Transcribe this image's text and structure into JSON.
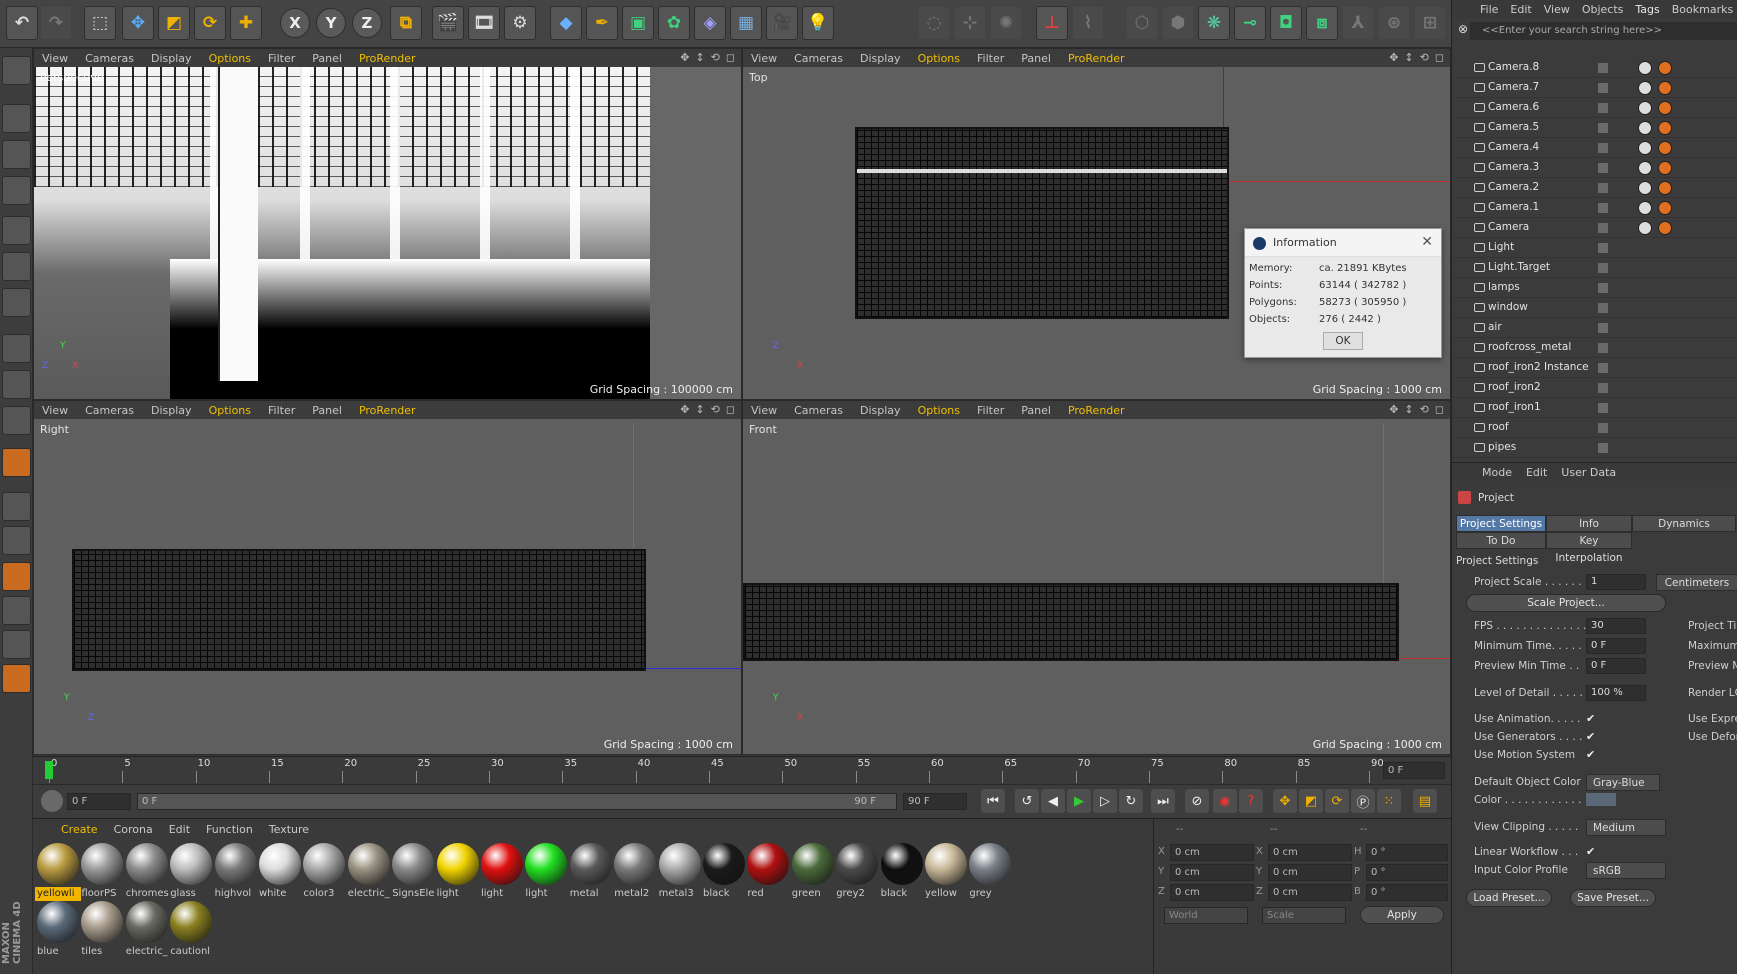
{
  "top_menu": [
    "File",
    "Edit",
    "View",
    "Objects",
    "Tags",
    "Bookmarks"
  ],
  "object_search_placeholder": "<<Enter your search string here>>",
  "viewport_menu": [
    "View",
    "Cameras",
    "Display",
    "Options",
    "Filter",
    "Panel",
    "ProRender"
  ],
  "viewports": {
    "perspective": {
      "label": "Perspective",
      "grid_spacing": "Grid Spacing : 100000 cm"
    },
    "top": {
      "label": "Top",
      "grid_spacing": "Grid Spacing : 1000 cm"
    },
    "right": {
      "label": "Right",
      "grid_spacing": "Grid Spacing : 1000 cm"
    },
    "front": {
      "label": "Front",
      "grid_spacing": "Grid Spacing : 1000 cm"
    }
  },
  "axes": {
    "x": "X",
    "y": "Y",
    "z": "Z"
  },
  "info_dialog": {
    "title": "Information",
    "rows": [
      {
        "label": "Memory:",
        "value": "ca. 21891 KBytes"
      },
      {
        "label": "Points:",
        "value": "63144 ( 342782 )"
      },
      {
        "label": "Polygons:",
        "value": "58273 ( 305950 )"
      },
      {
        "label": "Objects:",
        "value": "276 ( 2442 )"
      }
    ],
    "ok_label": "OK"
  },
  "objects": [
    "Camera.8",
    "Camera.7",
    "Camera.6",
    "Camera.5",
    "Camera.4",
    "Camera.3",
    "Camera.2",
    "Camera.1",
    "Camera",
    "Light",
    "Light.Target",
    "lamps",
    "window",
    "air",
    "roofcross_metal",
    "roof_iron2 Instance",
    "roof_iron2",
    "roof_iron1",
    "roof",
    "pipes"
  ],
  "timeline": {
    "ticks": [
      "0",
      "5",
      "10",
      "15",
      "20",
      "25",
      "30",
      "35",
      "40",
      "45",
      "50",
      "55",
      "60",
      "65",
      "70",
      "75",
      "80",
      "85",
      "90"
    ],
    "current_frame": "0 F",
    "start_field": "0 F",
    "range_start": "0 F",
    "range_end": "90 F",
    "end_field": "90 F"
  },
  "material_menu": [
    "Create",
    "Corona",
    "Edit",
    "Function",
    "Texture"
  ],
  "materials": [
    {
      "name": "yellowli",
      "color": "#b89a40",
      "selected": true
    },
    {
      "name": "floorPS",
      "color": "#9a9a9a"
    },
    {
      "name": "chromes",
      "color": "#8c8c8c"
    },
    {
      "name": "glass",
      "color": "#bcbcbc"
    },
    {
      "name": "highvol",
      "color": "#7a7a7a"
    },
    {
      "name": "white",
      "color": "#dcdcdc"
    },
    {
      "name": "color3",
      "color": "#a8a8a8"
    },
    {
      "name": "electric_",
      "color": "#9a9282"
    },
    {
      "name": "SignsEle",
      "color": "#8a8a8a"
    },
    {
      "name": "light",
      "color": "#f2d400"
    },
    {
      "name": "light",
      "color": "#e01010"
    },
    {
      "name": "light",
      "color": "#20e020"
    },
    {
      "name": "metal",
      "color": "#5a5a5a"
    },
    {
      "name": "metal2",
      "color": "#7a7a7a"
    },
    {
      "name": "metal3",
      "color": "#aaaaaa"
    },
    {
      "name": "black",
      "color": "#1a1a1a"
    },
    {
      "name": "red",
      "color": "#b01010"
    },
    {
      "name": "green",
      "color": "#4a6a3a"
    },
    {
      "name": "grey2",
      "color": "#4a4a4a"
    },
    {
      "name": "black",
      "color": "#101010"
    },
    {
      "name": "yellow",
      "color": "#c8b898"
    },
    {
      "name": "grey",
      "color": "#7a8088"
    },
    {
      "name": "blue",
      "color": "#5a6a7a"
    },
    {
      "name": "tiles",
      "color": "#a89c8c"
    },
    {
      "name": "electric_",
      "color": "#6a6a62"
    },
    {
      "name": "cautionl",
      "color": "#8a8020"
    }
  ],
  "coords": {
    "headers": [
      "--",
      "--",
      "--"
    ],
    "rows": [
      {
        "a": "X",
        "av": "0 cm",
        "b": "X",
        "bv": "0 cm",
        "c": "H",
        "cv": "0 °"
      },
      {
        "a": "Y",
        "av": "0 cm",
        "b": "Y",
        "bv": "0 cm",
        "c": "P",
        "cv": "0 °"
      },
      {
        "a": "Z",
        "av": "0 cm",
        "b": "Z",
        "bv": "0 cm",
        "c": "B",
        "cv": "0 °"
      }
    ],
    "world": "World",
    "scale": "Scale",
    "apply": "Apply"
  },
  "attributes": {
    "menu": [
      "Mode",
      "Edit",
      "User Data"
    ],
    "title": "Project",
    "tabs": [
      "Project Settings",
      "Info",
      "Dynamics",
      "To Do",
      "Key Interpolation"
    ],
    "section": "Project Settings",
    "project_scale_label": "Project Scale . . . . . .",
    "project_scale_value": "1",
    "project_scale_unit": "Centimeters",
    "scale_project_btn": "Scale Project...",
    "fps_label": "FPS . . . . . . . . . . . . . .",
    "fps_value": "30",
    "min_time_label": "Minimum Time. . . . .",
    "min_time_value": "0 F",
    "preview_min_label": "Preview Min Time . .",
    "preview_min_value": "0 F",
    "right_col": [
      "Project Tir",
      "Maximum",
      "Preview M"
    ],
    "lod_label": "Level of Detail . . . . .",
    "lod_value": "100 %",
    "render_lod": "Render LC",
    "use_animation": "Use Animation. . . . .",
    "use_generators": "Use Generators . . . .",
    "use_motion": "Use Motion System",
    "use_expr": "Use Expre",
    "use_defor": "Use Defor",
    "default_color_label": "Default Object Color",
    "default_color_value": "Gray-Blue",
    "color_label": "Color . . . . . . . . . . . .",
    "view_clipping_label": "View Clipping . . . . .",
    "view_clipping_value": "Medium",
    "linear_workflow_label": "Linear Workflow . . .",
    "input_color_label": "Input Color Profile",
    "input_color_value": "sRGB",
    "load_preset": "Load Preset...",
    "save_preset": "Save Preset..."
  }
}
